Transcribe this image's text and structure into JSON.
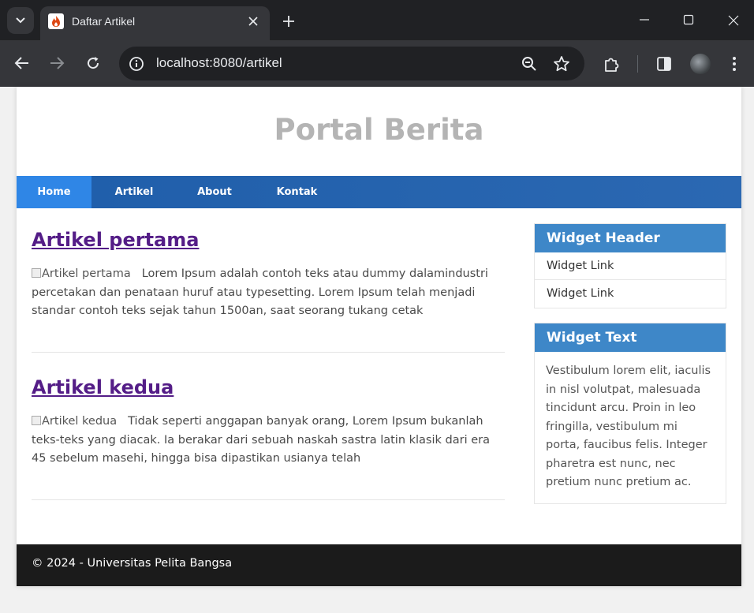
{
  "browser": {
    "tab_title": "Daftar Artikel",
    "url": "localhost:8080/artikel",
    "icons": [
      "tab-list-icon",
      "favicon-flame-icon",
      "close-tab-icon",
      "new-tab-icon",
      "minimize-icon",
      "maximize-icon",
      "close-window-icon",
      "back-icon",
      "forward-icon",
      "reload-icon",
      "site-info-icon",
      "zoom-icon",
      "bookmark-star-icon",
      "extensions-icon",
      "side-panel-icon",
      "profile-avatar",
      "menu-icon"
    ]
  },
  "page": {
    "site_title": "Portal Berita",
    "nav": [
      {
        "label": "Home",
        "active": true
      },
      {
        "label": "Artikel",
        "active": false
      },
      {
        "label": "About",
        "active": false
      },
      {
        "label": "Kontak",
        "active": false
      }
    ],
    "articles": [
      {
        "title": "Artikel pertama",
        "image_alt": "Artikel pertama",
        "body": "Lorem Ipsum adalah contoh teks atau dummy dalamindustri percetakan dan penataan huruf atau typesetting. Lorem Ipsum telah menjadi standar contoh teks sejak tahun 1500an, saat seorang tukang cetak"
      },
      {
        "title": "Artikel kedua",
        "image_alt": "Artikel kedua",
        "body": "Tidak seperti anggapan banyak orang, Lorem Ipsum bukanlah teks-teks yang diacak. Ia berakar dari sebuah naskah sastra latin klasik dari era 45 sebelum masehi, hingga bisa dipastikan usianya telah"
      }
    ],
    "widgets": {
      "header_widget": {
        "title": "Widget Header",
        "links": [
          "Widget Link",
          "Widget Link"
        ]
      },
      "text_widget": {
        "title": "Widget Text",
        "text": "Vestibulum lorem elit, iaculis in nisl volutpat, malesuada tincidunt arcu. Proin in leo fringilla, vestibulum mi porta, faucibus felis. Integer pharetra est nunc, nec pretium nunc pretium ac."
      }
    },
    "footer": "© 2024 - Universitas Pelita Bangsa"
  },
  "colors": {
    "nav_bar": "#1f5eaa",
    "nav_active": "#2f86e6",
    "widget_header": "#3e87c8",
    "article_link": "#541d87",
    "footer_bg": "#1b1b1b",
    "site_title": "#b4b4b4"
  }
}
